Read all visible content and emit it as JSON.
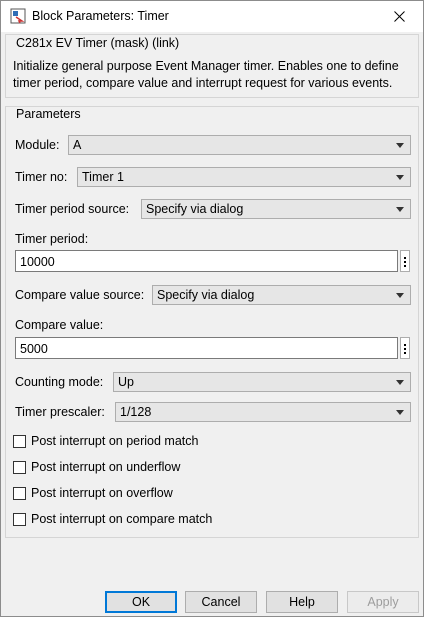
{
  "window": {
    "title": "Block Parameters: Timer",
    "icon": "simulink-block-icon",
    "close_icon": "close-icon"
  },
  "description": {
    "legend": "C281x EV Timer (mask) (link)",
    "text": "Initialize general purpose Event Manager timer. Enables one to define timer period, compare value and interrupt request for various events."
  },
  "parameters": {
    "legend": "Parameters",
    "module": {
      "label": "Module:",
      "value": "A"
    },
    "timer_no": {
      "label": "Timer no:",
      "value": "Timer 1"
    },
    "timer_period_source": {
      "label": "Timer period source:",
      "value": "Specify via dialog"
    },
    "timer_period": {
      "label": "Timer period:",
      "value": "10000"
    },
    "compare_value_source": {
      "label": "Compare value source:",
      "value": "Specify via dialog"
    },
    "compare_value": {
      "label": "Compare value:",
      "value": "5000"
    },
    "counting_mode": {
      "label": "Counting mode:",
      "value": "Up"
    },
    "timer_prescaler": {
      "label": "Timer prescaler:",
      "value": "1/128"
    },
    "checkboxes": [
      {
        "label": "Post interrupt on period match",
        "checked": false
      },
      {
        "label": "Post interrupt on underflow",
        "checked": false
      },
      {
        "label": "Post interrupt on overflow",
        "checked": false
      },
      {
        "label": "Post interrupt on compare match",
        "checked": false
      }
    ]
  },
  "buttons": {
    "ok": "OK",
    "cancel": "Cancel",
    "help": "Help",
    "apply": "Apply"
  },
  "colors": {
    "default_button_border": "#0078d7",
    "disabled_text": "#9d9d9d"
  }
}
